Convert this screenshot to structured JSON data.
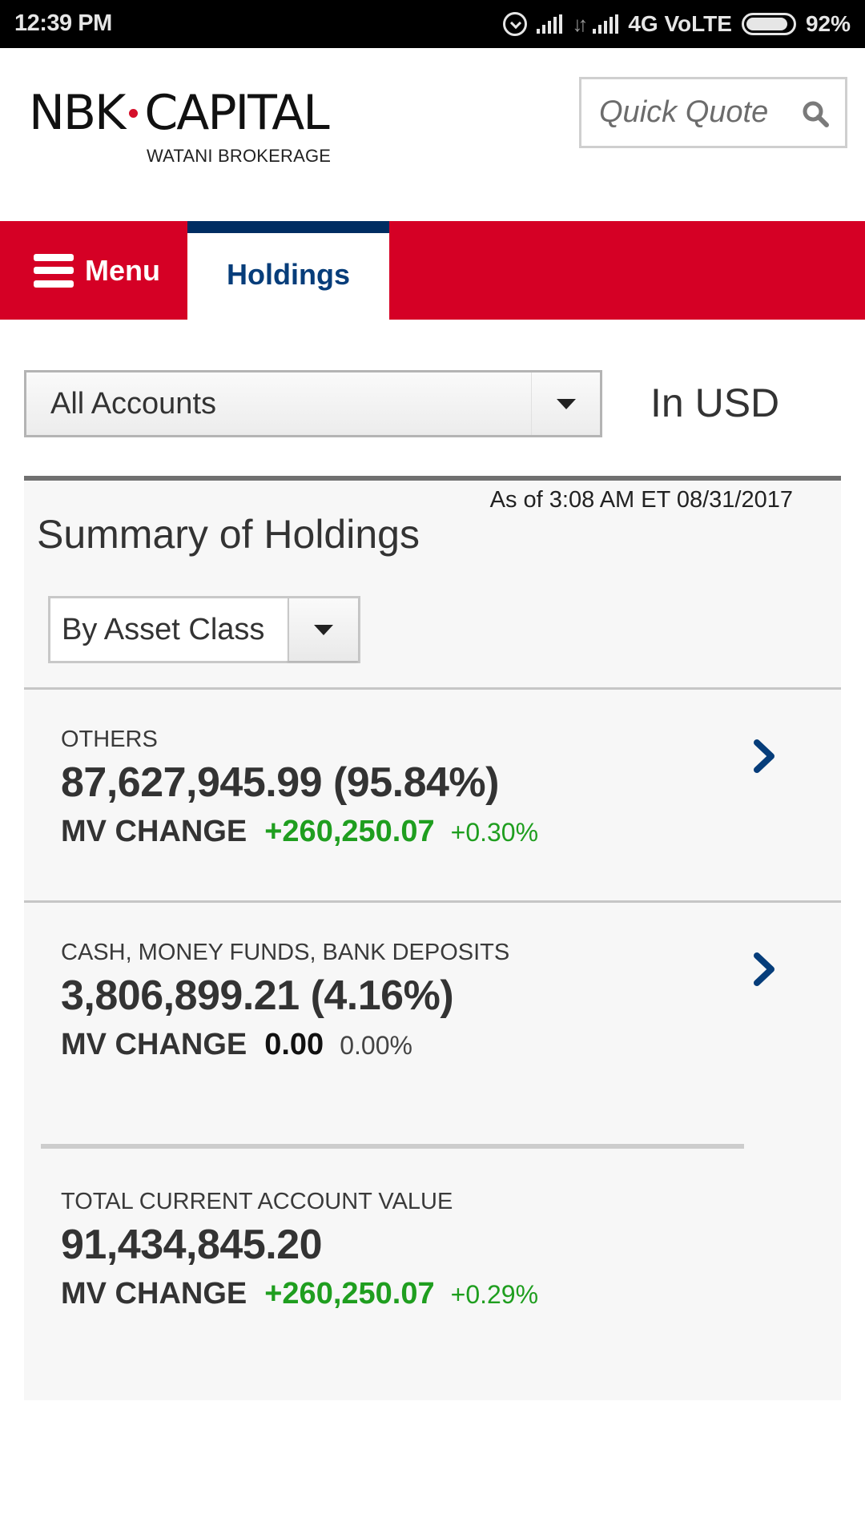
{
  "status_bar": {
    "time": "12:39 PM",
    "network": "4G VoLTE",
    "battery": "92%",
    "battery_level": 0.92
  },
  "header": {
    "logo_main_left": "NBK",
    "logo_main_right": "CAPITAL",
    "logo_sub": "WATANI BROKERAGE",
    "quick_quote_placeholder": "Quick Quote"
  },
  "nav": {
    "menu_label": "Menu",
    "active_tab": "Holdings"
  },
  "account_selector": {
    "selected": "All Accounts",
    "currency_label": "In USD"
  },
  "summary": {
    "as_of": "As of  3:08 AM ET 08/31/2017",
    "title": "Summary of Holdings",
    "group_by_selected": "By Asset Class",
    "mv_change_label": "MV CHANGE",
    "rows": [
      {
        "category": "OTHERS",
        "amount": "87,627,945.99 (95.84%)",
        "mv_change": "+260,250.07",
        "mv_change_pct": "+0.30%"
      },
      {
        "category": "CASH, MONEY FUNDS, BANK DEPOSITS",
        "amount": "3,806,899.21 (4.16%)",
        "mv_change": "0.00",
        "mv_change_pct": "0.00%"
      }
    ],
    "total": {
      "label": "TOTAL CURRENT ACCOUNT VALUE",
      "amount": "91,434,845.20",
      "mv_change": "+260,250.07",
      "mv_change_pct": "+0.29%"
    }
  },
  "colors": {
    "brand_red": "#d50025",
    "brand_navy": "#002d62",
    "positive_green": "#1f9e1f"
  }
}
